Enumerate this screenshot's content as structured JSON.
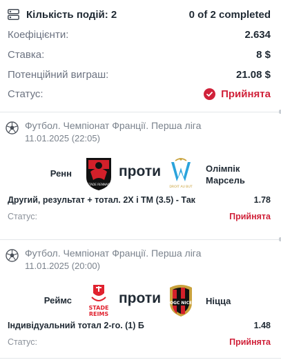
{
  "summary": {
    "events_label": "Кількість подій: 2",
    "completed": "0 of 2 completed",
    "odds_label": "Коефіцієнти:",
    "odds_value": "2.634",
    "stake_label": "Ставка:",
    "stake_value": "8 $",
    "potential_label": "Потенційний виграш:",
    "potential_value": "21.08 $",
    "status_label": "Статус:",
    "status_value": "Прийнята"
  },
  "bets": [
    {
      "league": "Футбол. Чемпіонат Франції. Перша ліга",
      "date": "11.01.2025 (22:05)",
      "home": "Ренн",
      "vs": "проти",
      "away_line1": "Олімпік",
      "away_line2": "Марсель",
      "home_logo_text": "STADE RENNAIS",
      "away_logo_text": "DROIT AU BUT",
      "market": "Другий, результат + тотал. 2X і ТМ (3.5) - Так",
      "odd": "1.78",
      "status_label": "Статус:",
      "status_value": "Прийнята"
    },
    {
      "league": "Футбол. Чемпіонат Франції. Перша ліга",
      "date": "11.01.2025 (20:00)",
      "home": "Реймс",
      "vs": "проти",
      "away_line1": "Ніцца",
      "home_logo_text_1": "STADE",
      "home_logo_text_2": "REIMS",
      "away_logo_text": "OGC NICE",
      "market": "Індивідуальний тотал 2-го. (1) Б",
      "odd": "1.48",
      "status_label": "Статус:",
      "status_value": "Прийнята"
    }
  ],
  "colors": {
    "accent_red": "#d0223a",
    "text_dark": "#1f2933",
    "text_muted": "#6b7280"
  },
  "icons": {
    "summary": "list-icon",
    "league": "soccer-ball-icon",
    "status": "check-circle-icon"
  }
}
